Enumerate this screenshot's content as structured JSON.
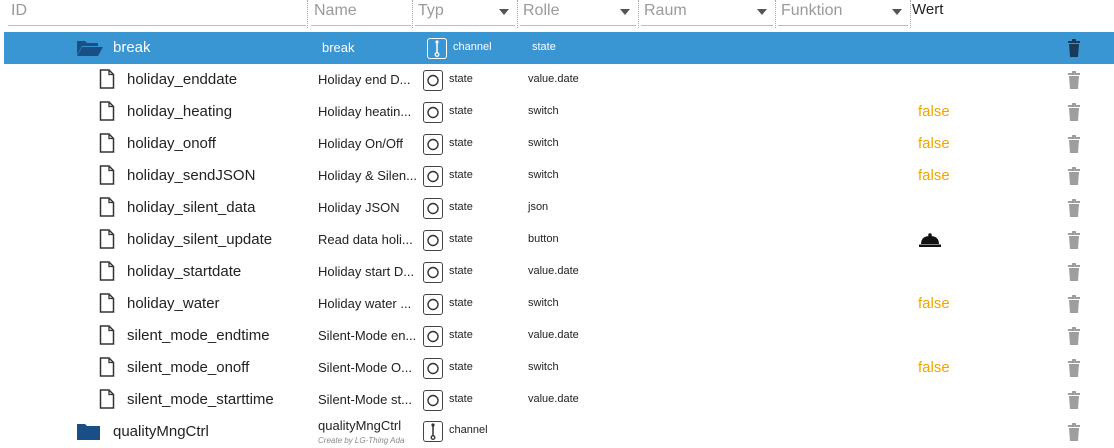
{
  "header": {
    "id_placeholder": "ID",
    "name_placeholder": "Name",
    "type_label": "Typ",
    "role_label": "Rolle",
    "room_label": "Raum",
    "function_label": "Funktion",
    "value_label": "Wert"
  },
  "rows": [
    {
      "id": "break",
      "name": "break",
      "type": "channel",
      "role": "state",
      "value": "",
      "kind": "folder-open",
      "selected": true
    },
    {
      "id": "holiday_enddate",
      "name": "Holiday end D...",
      "type": "state",
      "role": "value.date",
      "value": ""
    },
    {
      "id": "holiday_heating",
      "name": "Holiday heatin...",
      "type": "state",
      "role": "switch",
      "value": "false"
    },
    {
      "id": "holiday_onoff",
      "name": "Holiday On/Off",
      "type": "state",
      "role": "switch",
      "value": "false"
    },
    {
      "id": "holiday_sendJSON",
      "name": "Holiday & Silen...",
      "type": "state",
      "role": "switch",
      "value": "false"
    },
    {
      "id": "holiday_silent_data",
      "name": "Holiday JSON",
      "type": "state",
      "role": "json",
      "value": ""
    },
    {
      "id": "holiday_silent_update",
      "name": "Read data holi...",
      "type": "state",
      "role": "button",
      "value": "",
      "bell": true
    },
    {
      "id": "holiday_startdate",
      "name": "Holiday start D...",
      "type": "state",
      "role": "value.date",
      "value": ""
    },
    {
      "id": "holiday_water",
      "name": "Holiday water ...",
      "type": "state",
      "role": "switch",
      "value": "false"
    },
    {
      "id": "silent_mode_endtime",
      "name": "Silent-Mode en...",
      "type": "state",
      "role": "value.date",
      "value": ""
    },
    {
      "id": "silent_mode_onoff",
      "name": "Silent-Mode O...",
      "type": "state",
      "role": "switch",
      "value": "false"
    },
    {
      "id": "silent_mode_starttime",
      "name": "Silent-Mode st...",
      "type": "state",
      "role": "value.date",
      "value": ""
    },
    {
      "id": "qualityMngCtrl",
      "name": "qualityMngCtrl",
      "type": "channel",
      "role": "",
      "value": "",
      "kind": "folder",
      "subtitle": "Create by LG-Thing Ada"
    }
  ],
  "icons": {
    "folder_open": "folder-open-icon",
    "folder": "folder-icon",
    "file": "file-icon",
    "channel_type": "channel-type-icon",
    "state_type": "state-type-icon",
    "trash": "trash-icon",
    "bell": "bell-icon"
  },
  "colors": {
    "selected_row": "#3a96d2",
    "value_false": "#f0a500",
    "folder": "#1a4f86"
  }
}
